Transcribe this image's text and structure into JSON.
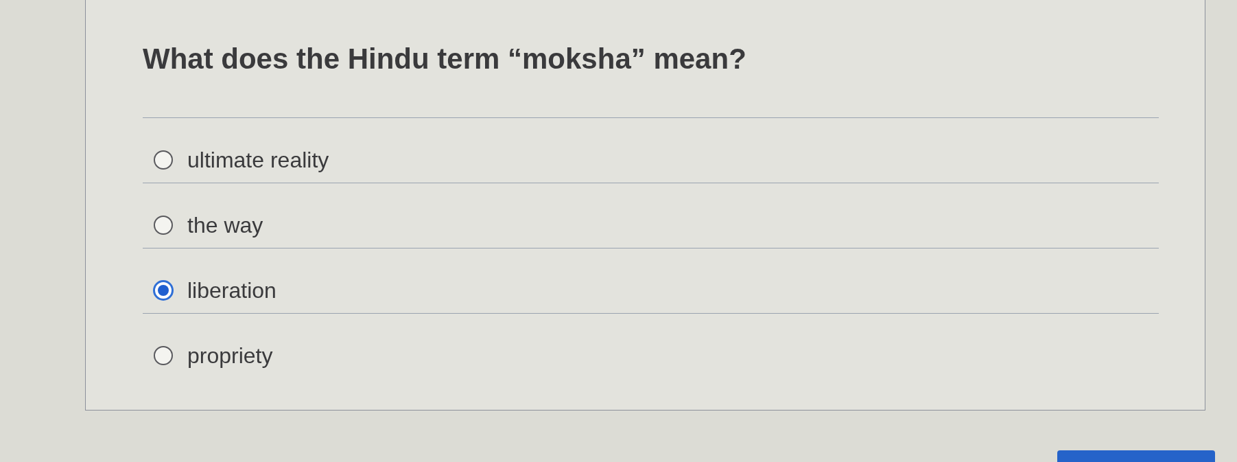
{
  "question": {
    "text": "What does the Hindu term “moksha” mean?"
  },
  "options": [
    {
      "label": "ultimate reality",
      "selected": false
    },
    {
      "label": "the way",
      "selected": false
    },
    {
      "label": "liberation",
      "selected": true
    },
    {
      "label": "propriety",
      "selected": false
    }
  ]
}
